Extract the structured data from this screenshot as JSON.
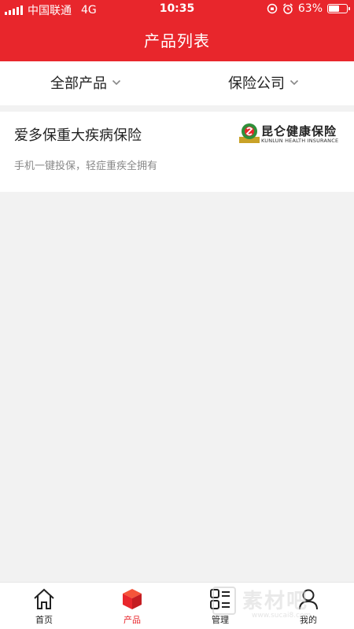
{
  "status_bar": {
    "carrier": "中国联通",
    "network": "4G",
    "time": "10:35",
    "battery_percent": "63%",
    "battery_level": 0.63
  },
  "header": {
    "title": "产品列表",
    "background_color": "#e8262c"
  },
  "filters": [
    {
      "label": "全部产品",
      "icon": "chevron-down-icon"
    },
    {
      "label": "保险公司",
      "icon": "chevron-down-icon"
    }
  ],
  "products": [
    {
      "name": "爱多保重大疾病保险",
      "description": "手机一键投保，轻症重疾全拥有",
      "company_logo": {
        "name_cn": "昆仑健康保险",
        "name_en": "KUNLUN HEALTH INSURANCE"
      }
    }
  ],
  "tab_bar": {
    "active_color": "#e8262c",
    "tabs": [
      {
        "label": "首页",
        "icon": "home-icon",
        "active": false
      },
      {
        "label": "产品",
        "icon": "cube-icon",
        "active": true
      },
      {
        "label": "管理",
        "icon": "grid-icon",
        "active": false
      },
      {
        "label": "我的",
        "icon": "user-icon",
        "active": false
      }
    ]
  },
  "watermark": {
    "text": "素材吧",
    "url": "www.sucai8.com"
  }
}
